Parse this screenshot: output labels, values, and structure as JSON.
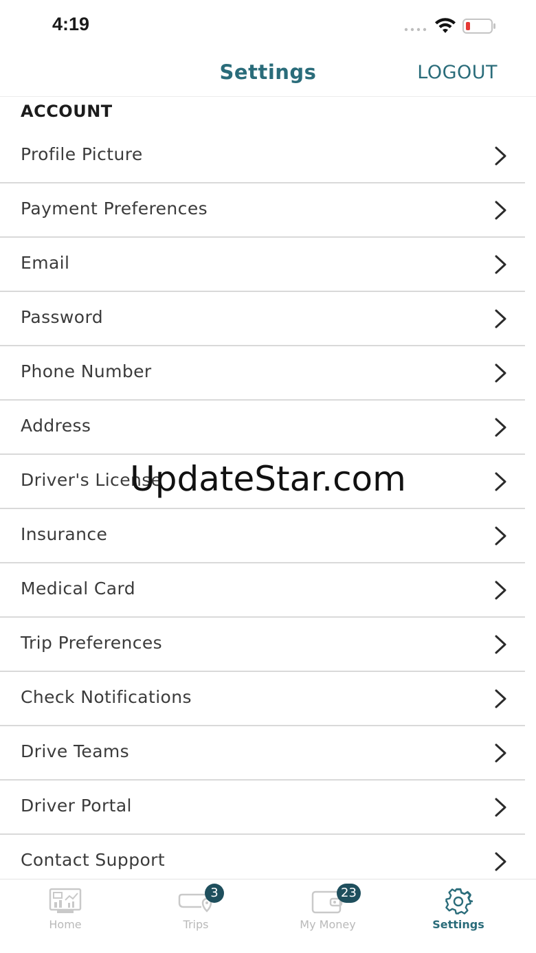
{
  "status_bar": {
    "time": "4:19"
  },
  "header": {
    "title": "Settings",
    "logout_label": "LOGOUT"
  },
  "section": {
    "title": "ACCOUNT"
  },
  "items": [
    {
      "label": "Profile Picture"
    },
    {
      "label": "Payment Preferences"
    },
    {
      "label": "Email"
    },
    {
      "label": "Password"
    },
    {
      "label": "Phone Number"
    },
    {
      "label": "Address"
    },
    {
      "label": "Driver's License"
    },
    {
      "label": "Insurance"
    },
    {
      "label": "Medical Card"
    },
    {
      "label": "Trip Preferences"
    },
    {
      "label": "Check Notifications"
    },
    {
      "label": "Drive Teams"
    },
    {
      "label": "Driver Portal"
    },
    {
      "label": "Contact Support"
    }
  ],
  "watermark": "UpdateStar.com",
  "tabs": [
    {
      "label": "Home",
      "icon": "dashboard-icon",
      "active": false
    },
    {
      "label": "Trips",
      "icon": "trips-icon",
      "badge": "3",
      "active": false
    },
    {
      "label": "My Money",
      "icon": "wallet-icon",
      "badge": "23",
      "active": false
    },
    {
      "label": "Settings",
      "icon": "gear-icon",
      "active": true
    }
  ],
  "colors": {
    "accent": "#2a6c7a",
    "badge": "#1f4f5d",
    "inactive": "#b9b9b9"
  }
}
